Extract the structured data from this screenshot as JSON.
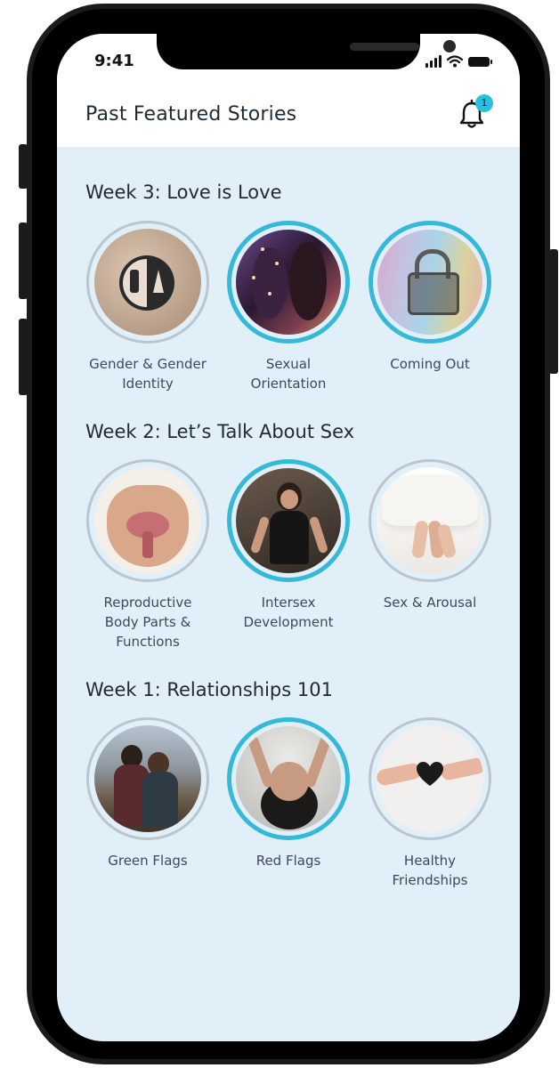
{
  "status_bar": {
    "time": "9:41"
  },
  "header": {
    "title": "Past Featured Stories",
    "notification_count": "1"
  },
  "colors": {
    "accent": "#35b9d6",
    "background": "#e1eff9",
    "seen_ring": "#b7c6cf"
  },
  "weeks": [
    {
      "title": "Week 3: Love is Love",
      "stories": [
        {
          "label": "Gender & Gender\nIdentity",
          "icon": "restroom-sign-image",
          "seen": true
        },
        {
          "label": "Sexual\nOrientation",
          "icon": "couple-kissing-image",
          "seen": false
        },
        {
          "label": "Coming Out",
          "icon": "padlock-rainbow-image",
          "seen": false
        }
      ]
    },
    {
      "title": "Week 2: Let’s Talk About Sex",
      "stories": [
        {
          "label": "Reproductive\nBody Parts &\nFunctions",
          "icon": "anatomy-diagram-image",
          "seen": true
        },
        {
          "label": "Intersex\nDevelopment",
          "icon": "person-portrait-image",
          "seen": false
        },
        {
          "label": "Sex & Arousal",
          "icon": "feet-in-bed-image",
          "seen": true
        }
      ]
    },
    {
      "title": "Week 1: Relationships 101",
      "stories": [
        {
          "label": "Green Flags",
          "icon": "couple-hug-image",
          "seen": true
        },
        {
          "label": "Red Flags",
          "icon": "hands-over-face-image",
          "seen": false
        },
        {
          "label": "Healthy\nFriendships",
          "icon": "heart-handoff-image",
          "seen": true
        }
      ]
    }
  ]
}
